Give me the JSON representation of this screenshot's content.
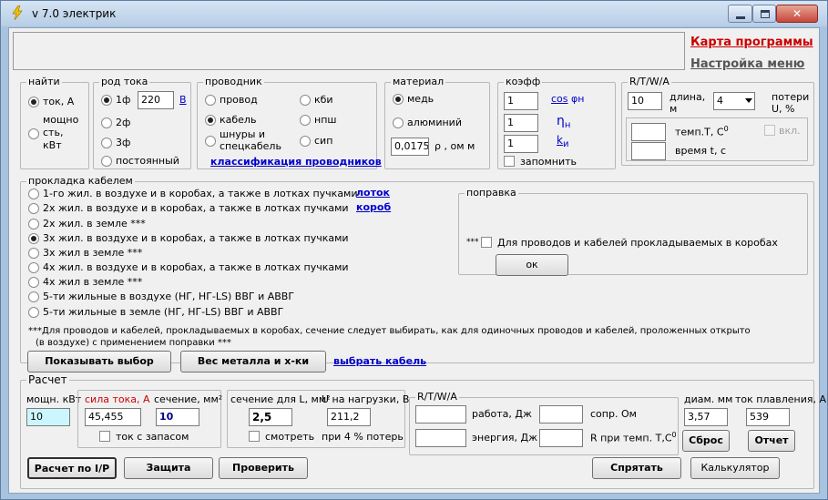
{
  "window": {
    "title": "v 7.0 электрик",
    "minimize": "–",
    "maximize": "□",
    "close": "✕"
  },
  "top_links": {
    "program_map": "Карта программы",
    "menu_settings": "Настройка меню"
  },
  "find": {
    "title": "найти",
    "current": "ток, А",
    "power_line1": "мощно",
    "power_line2": "сть,",
    "power_line3": "кВт"
  },
  "current_type": {
    "title": "род тока",
    "one_phase": "1ф",
    "voltage": "220",
    "voltage_unit": "В",
    "two_phase": "2ф",
    "three_phase": "3ф",
    "dc": "постоянный"
  },
  "conductor": {
    "title": "проводник",
    "wire": "провод",
    "cable": "кабель",
    "cords_line1": "шнуры и",
    "cords_line2": "спецкабель",
    "kbi": "кби",
    "npsh": "нпш",
    "sip": "сип",
    "classification_link": "классификация проводников"
  },
  "material": {
    "title": "материал",
    "copper": "медь",
    "aluminum": "алюминий",
    "resistivity": "0,0175",
    "resistivity_unit": "ρ , ом м"
  },
  "coeff": {
    "title": "коэфф",
    "cos_value": "1",
    "cos_label": "cos",
    "cos_sub": "φн",
    "eta_value": "1",
    "eta_label": "η",
    "eta_sub": "н",
    "k_value": "1",
    "k_label": "k",
    "k_sub": "и",
    "remember": "запомнить"
  },
  "rtwa_top": {
    "title": "R/T/W/A",
    "length_value": "10",
    "length_label1": "длина,",
    "length_label2": "м",
    "loss_select": "4",
    "loss_label1": "потери",
    "loss_label2": "U, %",
    "temp_label": "темп.T, C",
    "temp_sup": "0",
    "time_label": "время t, с",
    "enable": "вкл."
  },
  "laying": {
    "title": "прокладка кабелем",
    "options": [
      "1-го жил. в воздухе и в коробах, а также в лотках пучками",
      "2х жил. в воздухе и в коробах, а также в лотках пучками",
      "2х жил. в земле ***",
      "3х жил. в воздухе и в коробах, а также в лотках пучками",
      "3х жил в земле ***",
      "4х жил. в воздухе и в коробах, а также в лотках пучками",
      "4х жил в земле ***",
      "5-ти жильные в воздухе (НГ, НГ-LS) ВВГ и АВВГ",
      "5-ти жильные в земле (НГ, НГ-LS) ВВГ и АВВГ"
    ],
    "link_tray": "лоток",
    "link_duct": "короб",
    "note_line1": "***Для проводов и кабелей, прокладываемых в коробах, сечение следует выбирать, как для одиночных проводов и кабелей, проложенных открыто",
    "note_line2": "(в воздухе) с применением поправки ***"
  },
  "correction": {
    "title": "поправка",
    "stars": "***",
    "checkbox_label": "Для проводов и кабелей прокладываемых в коробах",
    "ok": "ок"
  },
  "actions": {
    "show_selection": "Показывать выбор",
    "metal_weight": "Вес металла и х-ки",
    "choose_cable": "выбрать кабель"
  },
  "calc": {
    "title": "Расчет",
    "power_label": "мощн. кВт",
    "power_value": "10",
    "current_label": "сила тока, А",
    "current_value": "45,455",
    "section_label": "сечение, мм²",
    "section_value": "10",
    "reserve": "ток с запасом",
    "section_L_label": "сечение для L, мм²",
    "section_L_value": "2,5",
    "u_load_label": "U на нагрузки, В",
    "u_load_value": "211,2",
    "watch": "смотреть",
    "loss_note": "при 4 % потерь",
    "rtwa_title": "R/T/W/A",
    "work_label": "работа, Дж",
    "energy_label": "энергия, Дж",
    "res_label": "сопр. Ом",
    "r_temp_label": "R при темп. T,C",
    "r_temp_sup": "0",
    "diam_label": "диам. мм",
    "diam_value": "3,57",
    "melt_label": "ток плавления, А",
    "melt_value": "539",
    "reset": "Сброс",
    "report": "Отчет"
  },
  "bottom": {
    "calc_ip": "Расчет по I/P",
    "protection": "Защита",
    "verify": "Проверить",
    "hide": "Спрятать",
    "calculator": "Калькулятор"
  }
}
